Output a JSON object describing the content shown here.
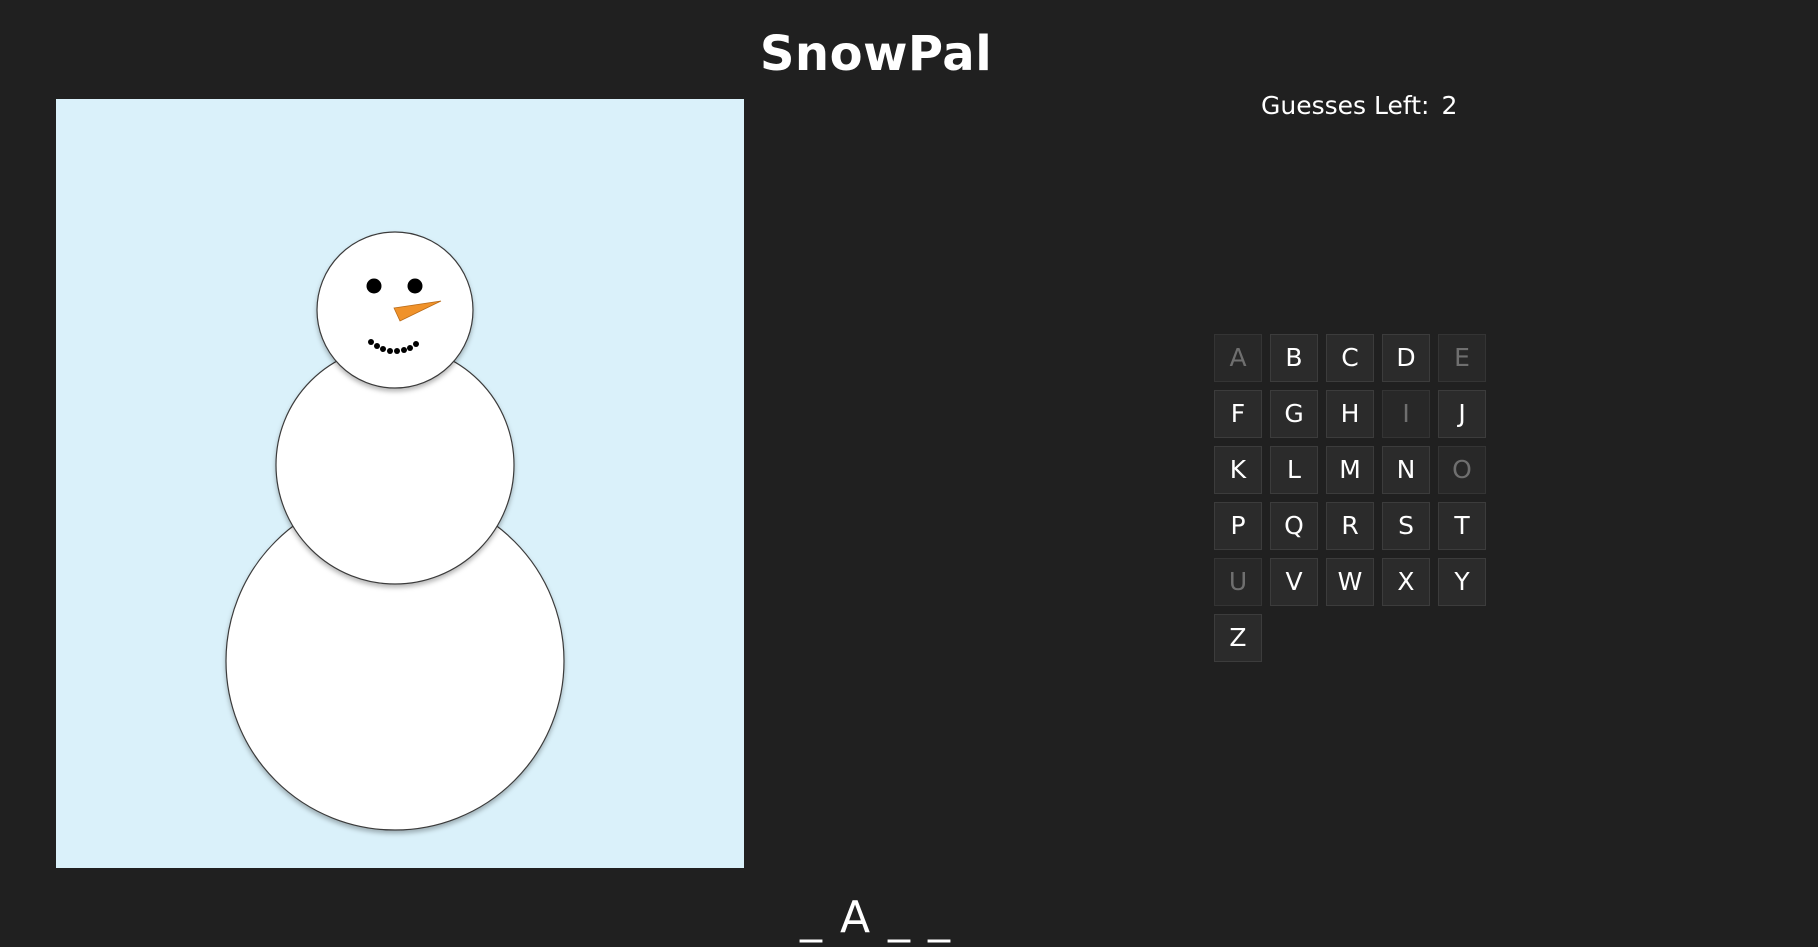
{
  "title": "SnowPal",
  "status": {
    "guesses_label": "Guesses Left:",
    "guesses_value": "2"
  },
  "word_display": "_ A _ _",
  "keyboard": {
    "keys": [
      {
        "letter": "A",
        "used": true
      },
      {
        "letter": "B",
        "used": false
      },
      {
        "letter": "C",
        "used": false
      },
      {
        "letter": "D",
        "used": false
      },
      {
        "letter": "E",
        "used": true
      },
      {
        "letter": "F",
        "used": false
      },
      {
        "letter": "G",
        "used": false
      },
      {
        "letter": "H",
        "used": false
      },
      {
        "letter": "I",
        "used": true
      },
      {
        "letter": "J",
        "used": false
      },
      {
        "letter": "K",
        "used": false
      },
      {
        "letter": "L",
        "used": false
      },
      {
        "letter": "M",
        "used": false
      },
      {
        "letter": "N",
        "used": false
      },
      {
        "letter": "O",
        "used": true
      },
      {
        "letter": "P",
        "used": false
      },
      {
        "letter": "Q",
        "used": false
      },
      {
        "letter": "R",
        "used": false
      },
      {
        "letter": "S",
        "used": false
      },
      {
        "letter": "T",
        "used": false
      },
      {
        "letter": "U",
        "used": true
      },
      {
        "letter": "V",
        "used": false
      },
      {
        "letter": "W",
        "used": false
      },
      {
        "letter": "X",
        "used": false
      },
      {
        "letter": "Y",
        "used": false
      },
      {
        "letter": "Z",
        "used": false
      }
    ]
  },
  "colors": {
    "background": "#202020",
    "canvas": "#daf1fa",
    "snow": "#ffffff",
    "outline": "#3a3a3a",
    "carrot": "#f0922a",
    "coal": "#000000"
  },
  "icons": {
    "snowman": "snowman-drawing"
  }
}
